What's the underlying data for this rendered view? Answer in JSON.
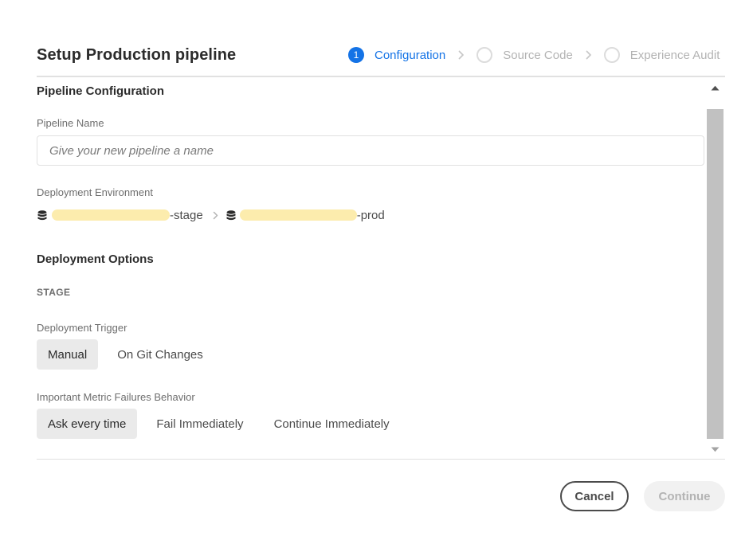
{
  "dialog": {
    "title": "Setup Production pipeline"
  },
  "stepper": {
    "steps": [
      {
        "number": "1",
        "label": "Configuration",
        "state": "active"
      },
      {
        "number": "",
        "label": "Source Code",
        "state": "inactive"
      },
      {
        "number": "",
        "label": "Experience Audit",
        "state": "inactive"
      }
    ]
  },
  "pipeline_configuration": {
    "section_title": "Pipeline Configuration",
    "pipeline_name": {
      "label": "Pipeline Name",
      "value": "",
      "placeholder": "Give your new pipeline a name"
    },
    "deployment_environment": {
      "label": "Deployment Environment",
      "source": {
        "icon": "database-icon",
        "suffix": "-stage",
        "redacted": true
      },
      "target": {
        "icon": "database-icon",
        "suffix": "-prod",
        "redacted": true
      }
    }
  },
  "deployment_options": {
    "section_title": "Deployment Options",
    "stage_heading": "STAGE",
    "deployment_trigger": {
      "label": "Deployment Trigger",
      "options": [
        "Manual",
        "On Git Changes"
      ],
      "selected": "Manual"
    },
    "metric_failures": {
      "label": "Important Metric Failures Behavior",
      "options": [
        "Ask every time",
        "Fail Immediately",
        "Continue Immediately"
      ],
      "selected": "Ask every time"
    }
  },
  "footer": {
    "cancel_label": "Cancel",
    "continue_label": "Continue",
    "continue_enabled": false
  },
  "colors": {
    "accent": "#1473e6",
    "title_text": "#2c2c2c",
    "muted_text": "#6e6e6e",
    "disabled_text": "#b3b3b3",
    "selected_segment_bg": "#eaeaea",
    "redaction_highlight": "#fcecad",
    "scrollbar_thumb": "#c1c1c1"
  }
}
